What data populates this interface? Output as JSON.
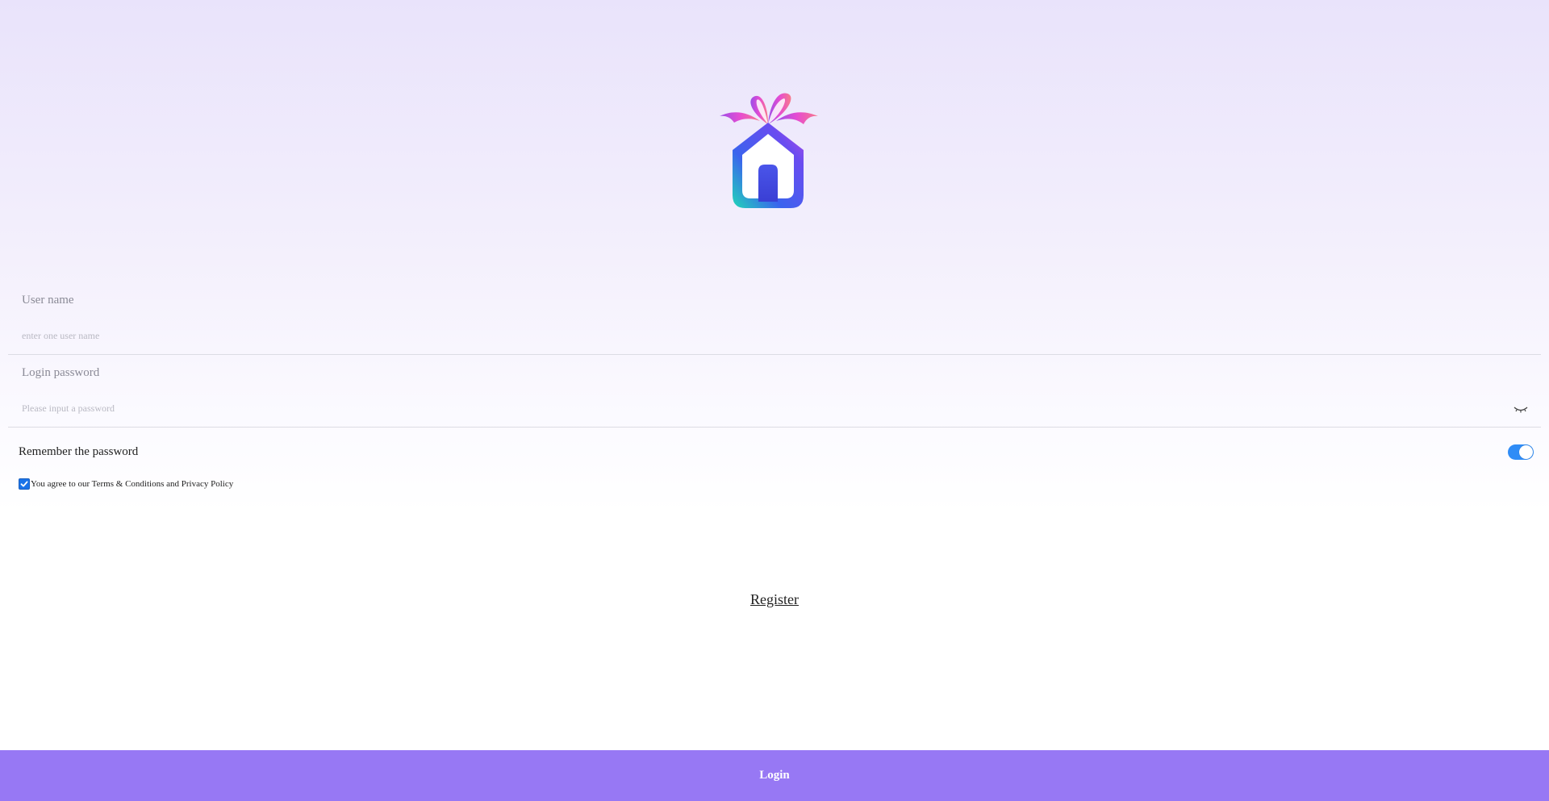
{
  "logo": {
    "icon": "gift-house-logo"
  },
  "form": {
    "username": {
      "label": "User name",
      "placeholder": "enter one user name",
      "value": ""
    },
    "password": {
      "label": "Login password",
      "placeholder": "Please input a password",
      "value": "",
      "visibility_icon": "eye-closed-icon"
    },
    "remember": {
      "label": "Remember the password",
      "enabled": true
    },
    "agreement": {
      "label": "You agree to our Terms & Conditions and Privacy Policy",
      "checked": true
    }
  },
  "register_label": "Register",
  "login_label": "Login",
  "colors": {
    "accent": "#9778f4",
    "toggle_on": "#2f8cf6",
    "checkbox": "#1a73e8"
  }
}
